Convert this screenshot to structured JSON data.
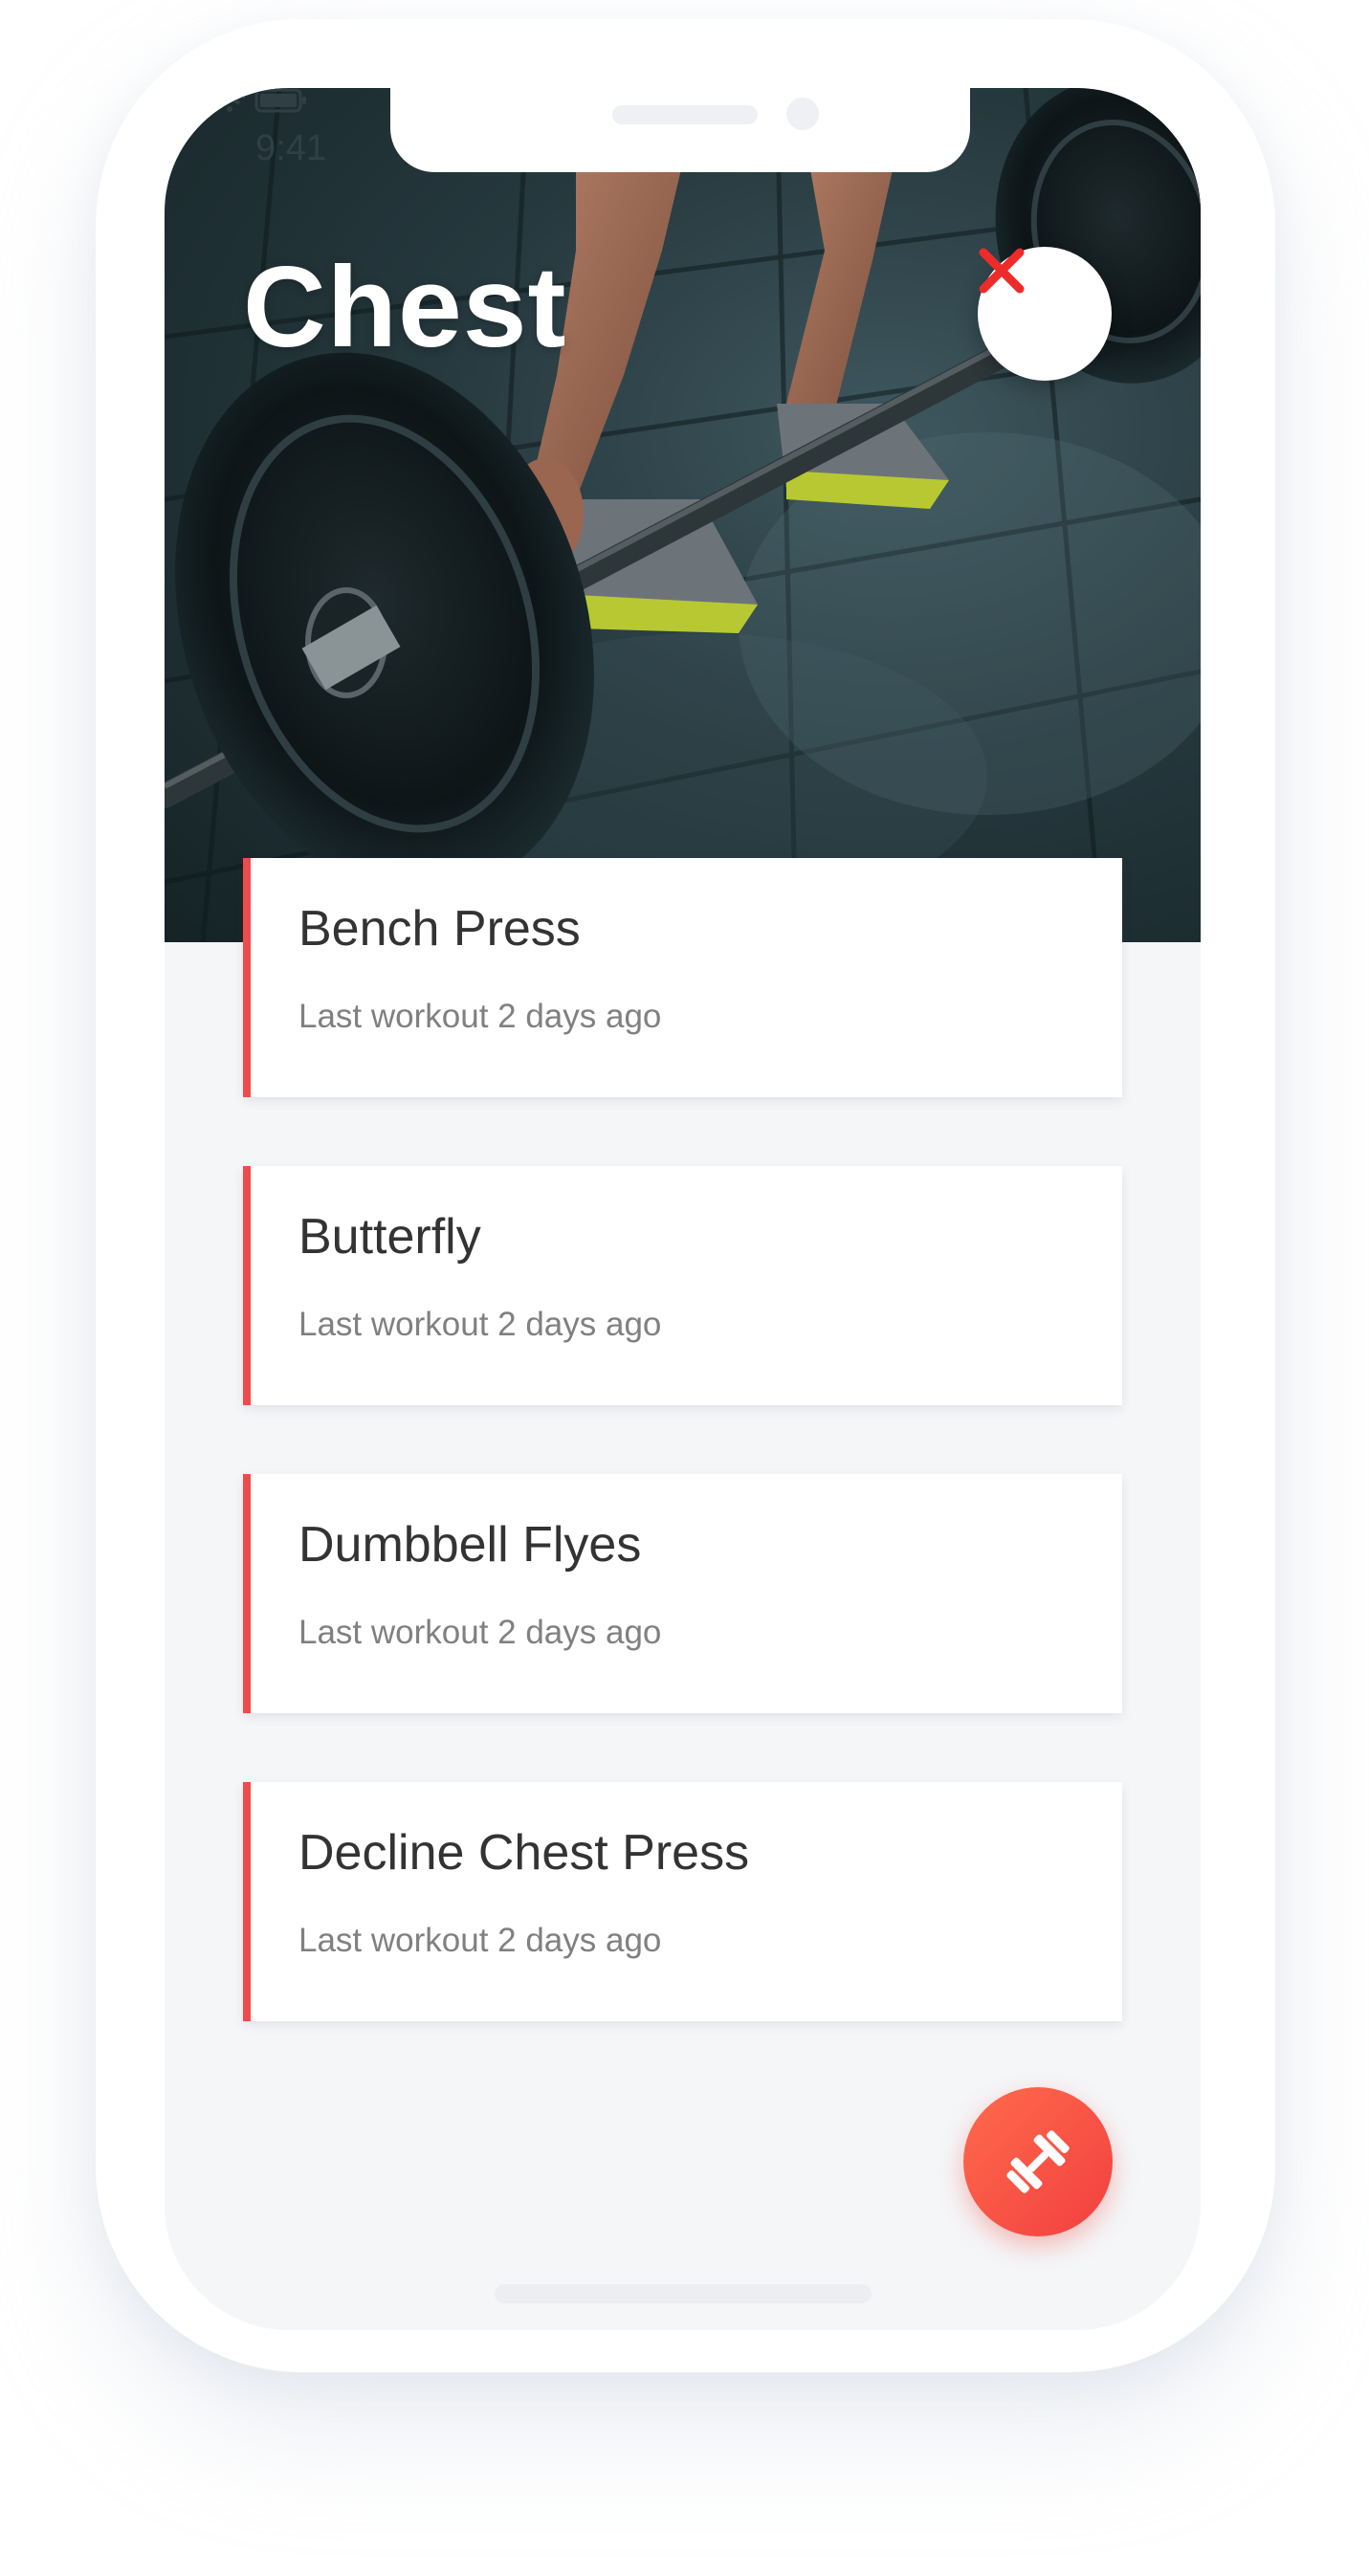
{
  "status_bar": {
    "time": "9:41"
  },
  "header": {
    "title": "Chest",
    "close_icon": "close-icon"
  },
  "workouts": [
    {
      "name": "Bench Press",
      "last_workout": "Last workout 2 days ago"
    },
    {
      "name": "Butterfly",
      "last_workout": "Last workout 2 days ago"
    },
    {
      "name": "Dumbbell Flyes",
      "last_workout": "Last workout 2 days ago"
    },
    {
      "name": "Decline Chest Press",
      "last_workout": "Last workout 2 days ago"
    }
  ],
  "fab": {
    "icon": "dumbbell-icon"
  },
  "colors": {
    "accent": "#ef4b4c",
    "fab_start": "#ff6b4d",
    "fab_end": "#f23f3f",
    "background": "#f5f6f8"
  }
}
